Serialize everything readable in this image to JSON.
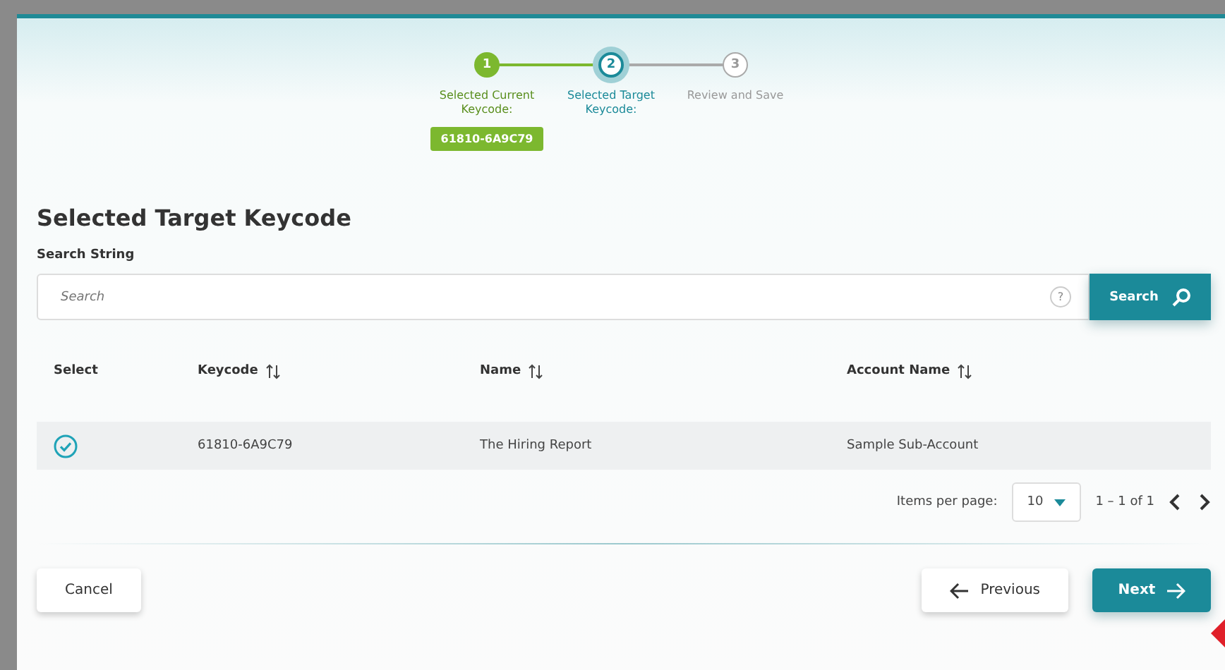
{
  "stepper": {
    "steps": [
      {
        "number": "1",
        "label": "Selected Current Keycode:",
        "done": true,
        "selected": false,
        "value": "61810-6A9C79"
      },
      {
        "number": "2",
        "label": "Selected Target Keycode:",
        "done": false,
        "selected": true
      },
      {
        "number": "3",
        "label": "Review and Save",
        "done": false,
        "selected": false
      }
    ]
  },
  "heading": "Selected Target Keycode",
  "search": {
    "label": "Search String",
    "placeholder": "Search",
    "help": "?",
    "button": "Search"
  },
  "table": {
    "columns": [
      {
        "label": "Select",
        "sortable": false
      },
      {
        "label": "Keycode",
        "sortable": true
      },
      {
        "label": "Name",
        "sortable": true
      },
      {
        "label": "Account Name",
        "sortable": true
      }
    ],
    "rows": [
      {
        "selected": true,
        "keycode": "61810-6A9C79",
        "name": "The Hiring Report",
        "account_name": "Sample Sub-Account"
      }
    ]
  },
  "pagination": {
    "label": "Items per page:",
    "page_size": "10",
    "range": "1 – 1 of 1"
  },
  "footer": {
    "cancel": "Cancel",
    "previous": "Previous",
    "next": "Next"
  }
}
